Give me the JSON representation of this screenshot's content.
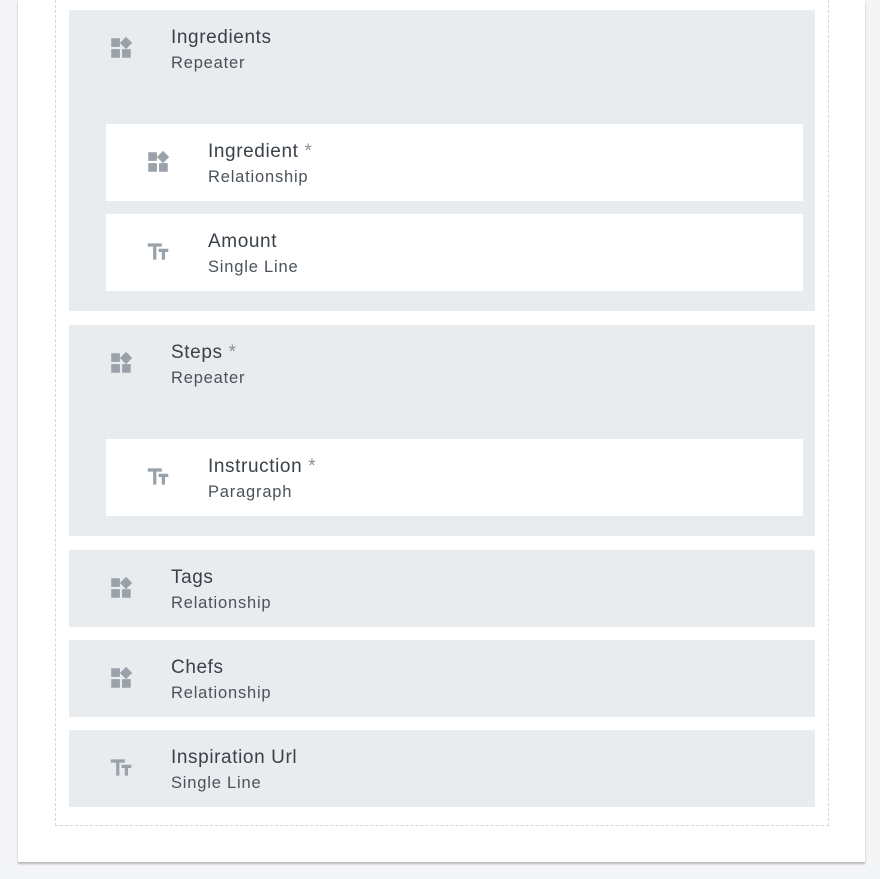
{
  "colors": {
    "card_background": "#ffffff",
    "field_background": "#e9ecef",
    "icon_color": "#9aa1a8",
    "label_color": "#3a4149",
    "type_color": "#4a525b"
  },
  "fields": [
    {
      "label": "Ingredients",
      "required": false,
      "type": "Repeater",
      "icon": "widgets-icon",
      "children": [
        {
          "label": "Ingredient",
          "required": true,
          "required_mark": "*",
          "type": "Relationship",
          "icon": "widgets-icon"
        },
        {
          "label": "Amount",
          "required": false,
          "type": "Single Line",
          "icon": "text-fields-icon"
        }
      ]
    },
    {
      "label": "Steps",
      "required": true,
      "required_mark": "*",
      "type": "Repeater",
      "icon": "widgets-icon",
      "children": [
        {
          "label": "Instruction",
          "required": true,
          "required_mark": "*",
          "type": "Paragraph",
          "icon": "text-fields-icon"
        }
      ]
    },
    {
      "label": "Tags",
      "required": false,
      "type": "Relationship",
      "icon": "widgets-icon"
    },
    {
      "label": "Chefs",
      "required": false,
      "type": "Relationship",
      "icon": "widgets-icon"
    },
    {
      "label": "Inspiration Url",
      "required": false,
      "type": "Single Line",
      "icon": "text-fields-icon"
    }
  ]
}
